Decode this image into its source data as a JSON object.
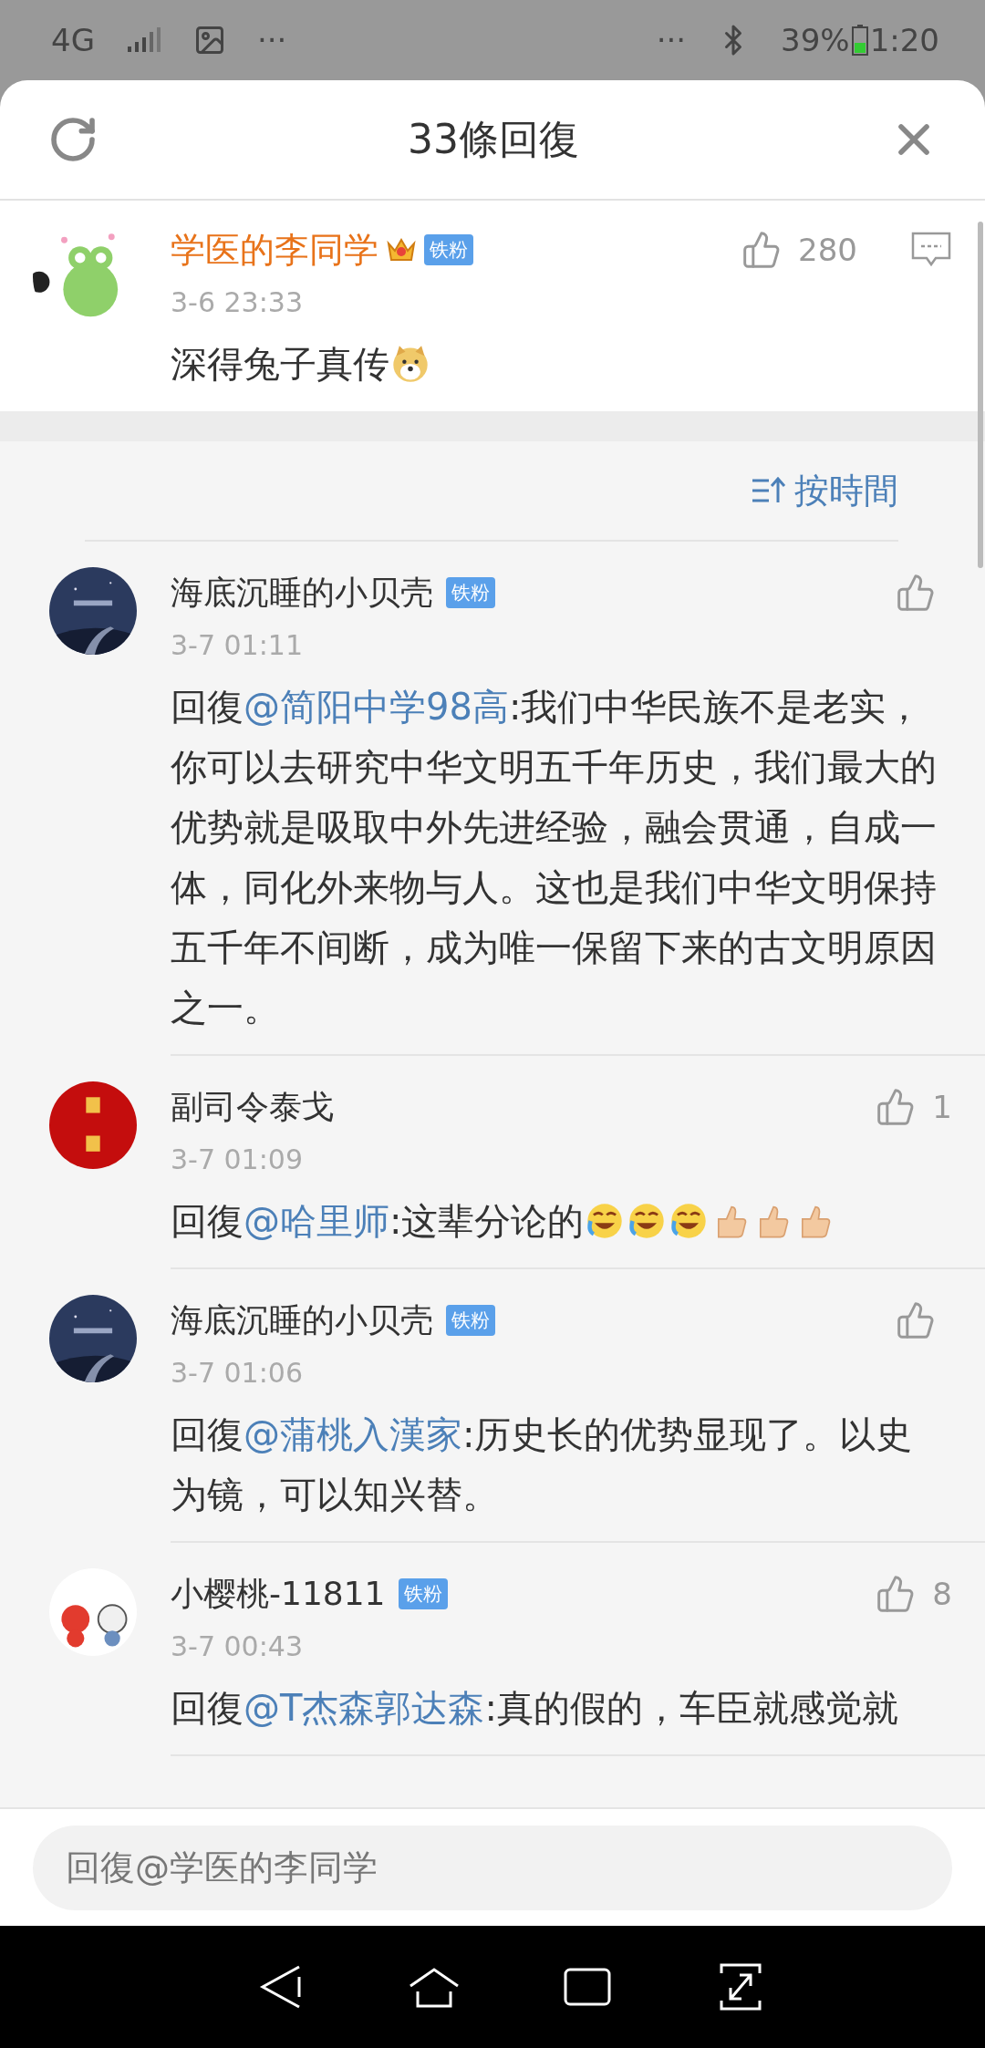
{
  "status_bar": {
    "network": "4G",
    "left_more": "···",
    "right_more": "···",
    "battery": "39%",
    "time": "1:20"
  },
  "header": {
    "title": "33條回復"
  },
  "main_comment": {
    "author": "学医的李同学",
    "crown": true,
    "badge": "铁粉",
    "time": "3-6 23:33",
    "likes": "280",
    "text": "深得兔子真传",
    "emojis": [
      {
        "kind": "doge"
      }
    ]
  },
  "sort": {
    "label": "按時間"
  },
  "replies": [
    {
      "author": "海底沉睡的小贝壳",
      "badge": "铁粉",
      "time": "3-7 01:11",
      "prefix": "回復",
      "mention": "@简阳中学98高",
      "text": ":我们中华民族不是老实，你可以去研究中华文明五千年历史，我们最大的优势就是吸取中外先进经验，融会贯通，自成一体，同化外来物与人。这也是我们中华文明保持五千年不间断，成为唯一保留下来的古文明原因之一。"
    },
    {
      "author": "副司令泰戈",
      "time": "3-7 01:09",
      "likes": "1",
      "prefix": "回復",
      "mention": "@哈里师",
      "text": ":这辈分论的",
      "emojis": [
        {
          "kind": "laugh"
        },
        {
          "kind": "laugh"
        },
        {
          "kind": "laugh"
        },
        {
          "kind": "thumb"
        },
        {
          "kind": "thumb"
        },
        {
          "kind": "thumb"
        }
      ]
    },
    {
      "author": "海底沉睡的小贝壳",
      "badge": "铁粉",
      "time": "3-7 01:06",
      "prefix": "回復",
      "mention": "@蒲桃入漢家",
      "text": ":历史长的优势显现了。以史为镜，可以知兴替。"
    },
    {
      "author": "小樱桃-11811",
      "badge": "铁粉",
      "time": "3-7 00:43",
      "likes": "8",
      "prefix": "回復",
      "mention": "@T杰森郭达森",
      "text": ":真的假的，车臣就感觉就"
    }
  ],
  "reply_field": {
    "placeholder": "回復@学医的李同学"
  }
}
